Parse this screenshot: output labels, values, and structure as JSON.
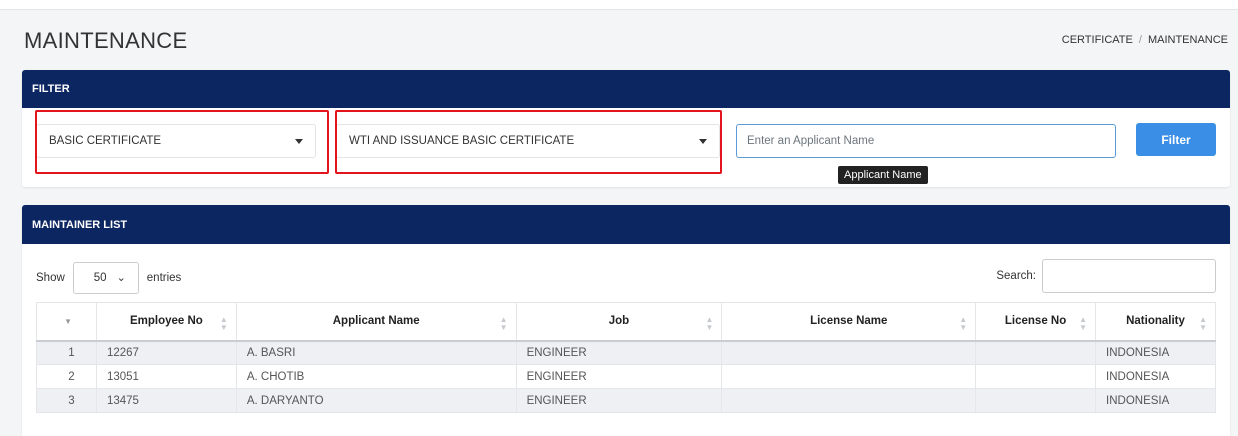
{
  "page": {
    "title": "MAINTENANCE"
  },
  "breadcrumb": {
    "items": [
      "CERTIFICATE",
      "MAINTENANCE"
    ],
    "separator": "/"
  },
  "filter": {
    "header": "FILTER",
    "certificate_select": "BASIC CERTIFICATE",
    "type_select": "WTI AND ISSUANCE BASIC CERTIFICATE",
    "name_placeholder": "Enter an Applicant Name",
    "name_value": "",
    "button_label": "Filter",
    "tooltip": "Applicant Name"
  },
  "list": {
    "header": "MAINTAINER LIST",
    "show_label": "Show",
    "entries_value": "50",
    "entries_label": "entries",
    "search_label": "Search:",
    "columns": [
      "",
      "Employee No",
      "Applicant Name",
      "Job",
      "License Name",
      "License No",
      "Nationality"
    ],
    "rows": [
      {
        "index": "1",
        "employee_no": "12267",
        "name": "A. BASRI",
        "job": "ENGINEER",
        "license_name": "",
        "license_no": "",
        "nationality": "INDONESIA"
      },
      {
        "index": "2",
        "employee_no": "13051",
        "name": "A. CHOTIB",
        "job": "ENGINEER",
        "license_name": "",
        "license_no": "",
        "nationality": "INDONESIA"
      },
      {
        "index": "3",
        "employee_no": "13475",
        "name": "A. DARYANTO",
        "job": "ENGINEER",
        "license_name": "",
        "license_no": "",
        "nationality": "INDONESIA"
      }
    ]
  },
  "colors": {
    "header_bg": "#0b2661",
    "button": "#3a8ee6",
    "highlight": "#e3141b",
    "link": "#2f7fd1"
  }
}
